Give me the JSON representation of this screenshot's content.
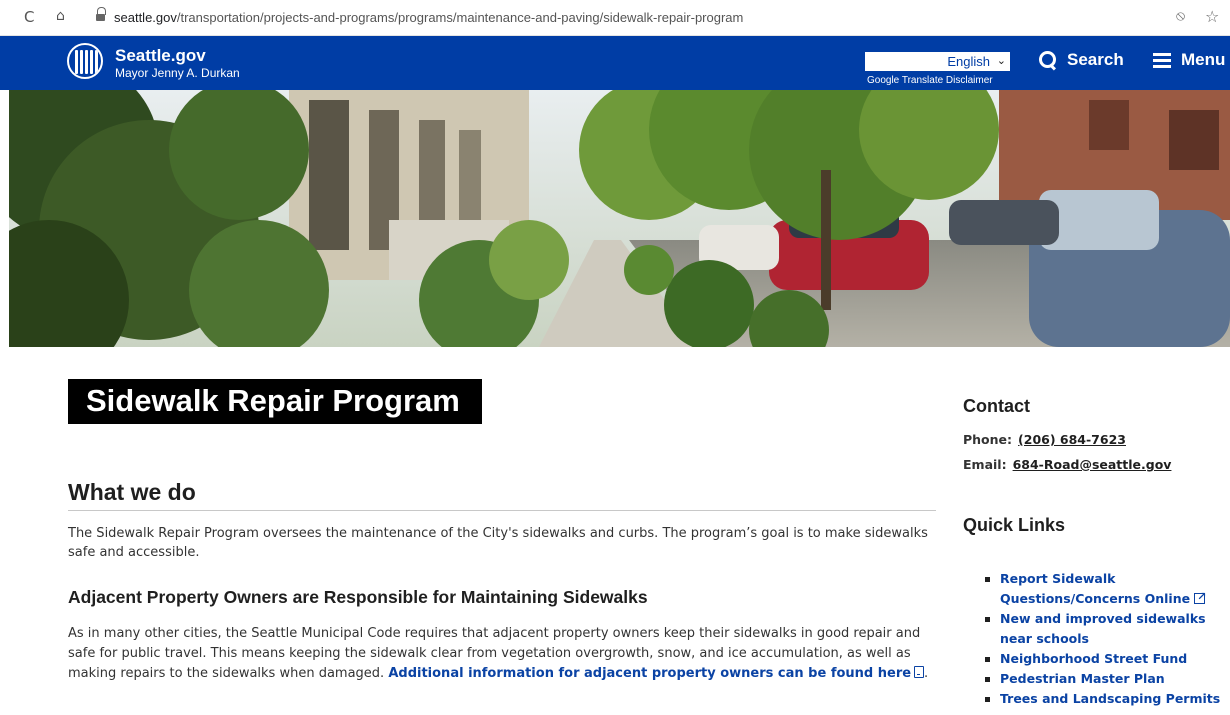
{
  "browser": {
    "url_domain": "seattle.gov",
    "url_path": "/transportation/projects-and-programs/programs/maintenance-and-paving/sidewalk-repair-program",
    "reload_glyph": "C",
    "home_glyph": "⌂",
    "privacy_glyph": "⦸",
    "star_glyph": "☆"
  },
  "header": {
    "site_name": "Seattle.gov",
    "mayor": "Mayor Jenny A. Durkan",
    "language": "English",
    "language_chevron": "⌄",
    "translate_disclaimer": "Google Translate Disclaimer",
    "search_label": "Search",
    "menu_label": "Menu",
    "brand_color": "#003da5"
  },
  "main": {
    "page_title": "Sidewalk Repair Program",
    "section_title": "What we do",
    "intro": "The Sidewalk Repair Program oversees the maintenance of the City's sidewalks and curbs. The program’s goal is to make sidewalks safe and accessible.",
    "subsection_title": "Adjacent Property Owners are Responsible for Maintaining Sidewalks",
    "body_text": "As in many other cities, the Seattle Municipal Code requires that adjacent property owners keep their sidewalks in good repair and safe for public travel. This means keeping the sidewalk clear from vegetation overgrowth, snow, and ice accumulation, as well as making repairs to the sidewalks when damaged. ",
    "body_link": "Additional information for adjacent property owners can be found here",
    "body_end": ".",
    "link_color": "#0b43a4"
  },
  "sidebar": {
    "contact_title": "Contact",
    "phone_label": "Phone:",
    "phone": "(206) 684-7623",
    "email_label": "Email:",
    "email": "684-Road@seattle.gov",
    "quick_links_title": "Quick Links",
    "quick_links": [
      {
        "label": "Report Sidewalk Questions/Concerns Online",
        "external": true
      },
      {
        "label": "New and improved sidewalks near schools"
      },
      {
        "label": "Neighborhood Street Fund"
      },
      {
        "label": "Pedestrian Master Plan"
      },
      {
        "label": "Trees and Landscaping Permits"
      }
    ]
  }
}
